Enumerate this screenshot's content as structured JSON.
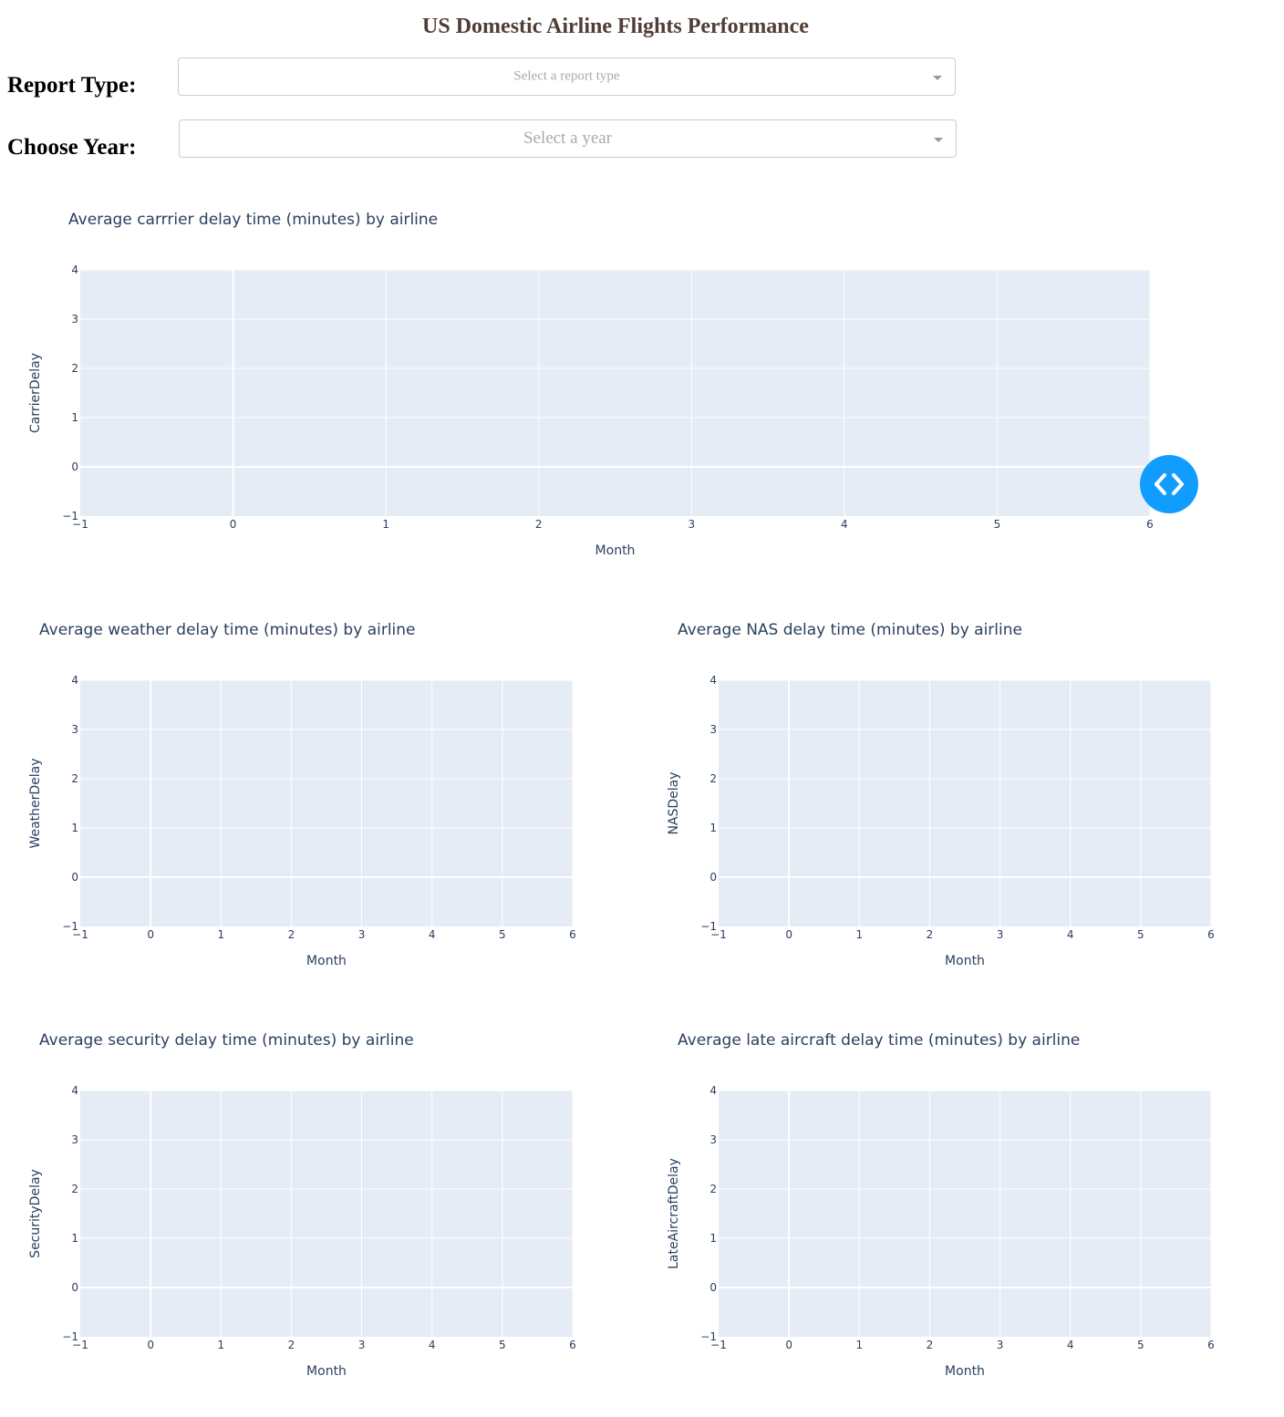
{
  "page": {
    "title": "US Domestic Airline Flights Performance",
    "report_type_label": "Report Type:",
    "report_type_placeholder": "Select a report type",
    "year_label": "Choose Year:",
    "year_placeholder": "Select a year"
  },
  "colors": {
    "title": "#503D36",
    "plot_bg": "#E5ECF6",
    "fab": "#119DFF"
  },
  "icons": {
    "fab": "code-brackets-icon",
    "dropdown": "chevron-down-icon"
  },
  "chart_data": [
    {
      "type": "line",
      "title": "Average carrrier delay time (minutes) by airline",
      "xlabel": "Month",
      "ylabel": "CarrierDelay",
      "xlim": [
        -1,
        6
      ],
      "ylim": [
        -1,
        4
      ],
      "grid": true,
      "series": []
    },
    {
      "type": "line",
      "title": "Average weather delay time (minutes) by airline",
      "xlabel": "Month",
      "ylabel": "WeatherDelay",
      "xlim": [
        -1,
        6
      ],
      "ylim": [
        -1,
        4
      ],
      "grid": true,
      "series": []
    },
    {
      "type": "line",
      "title": "Average NAS delay time (minutes) by airline",
      "xlabel": "Month",
      "ylabel": "NASDelay",
      "xlim": [
        -1,
        6
      ],
      "ylim": [
        -1,
        4
      ],
      "grid": true,
      "series": []
    },
    {
      "type": "line",
      "title": "Average security delay time (minutes) by airline",
      "xlabel": "Month",
      "ylabel": "SecurityDelay",
      "xlim": [
        -1,
        6
      ],
      "ylim": [
        -1,
        4
      ],
      "grid": true,
      "series": []
    },
    {
      "type": "line",
      "title": "Average late aircraft delay time (minutes) by airline",
      "xlabel": "Month",
      "ylabel": "LateAircraftDelay",
      "xlim": [
        -1,
        6
      ],
      "ylim": [
        -1,
        4
      ],
      "grid": true,
      "series": []
    }
  ]
}
